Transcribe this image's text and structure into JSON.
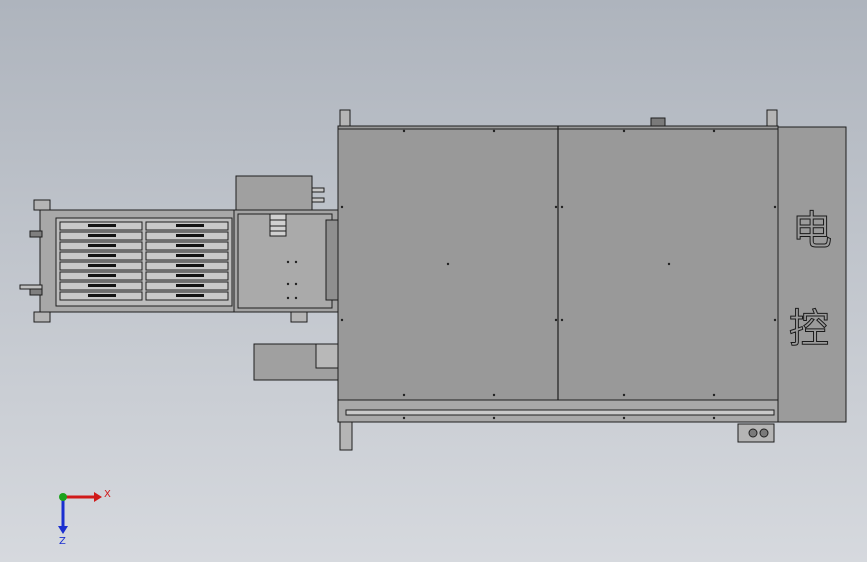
{
  "viewport": {
    "background_top": "#aeb4bd",
    "background_bottom": "#d6d9de"
  },
  "model": {
    "body_color": "#999999",
    "line_color": "#1e1e1e",
    "cover_panel_color": "#9b9b9b",
    "rail_color": "#c9c9c9",
    "side_panel_text": [
      "电",
      "控"
    ]
  },
  "triad": {
    "x_label": "X",
    "z_label": "Z",
    "x_color": "#d01a1a",
    "y_color": "#1ca21c",
    "z_color": "#1a2fd0"
  }
}
